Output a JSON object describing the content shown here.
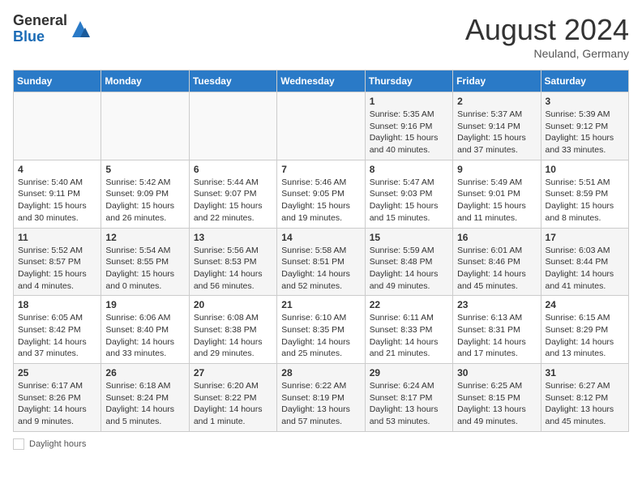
{
  "header": {
    "logo_general": "General",
    "logo_blue": "Blue",
    "month_year": "August 2024",
    "location": "Neuland, Germany"
  },
  "days_of_week": [
    "Sunday",
    "Monday",
    "Tuesday",
    "Wednesday",
    "Thursday",
    "Friday",
    "Saturday"
  ],
  "weeks": [
    [
      {
        "day": "",
        "info": ""
      },
      {
        "day": "",
        "info": ""
      },
      {
        "day": "",
        "info": ""
      },
      {
        "day": "",
        "info": ""
      },
      {
        "day": "1",
        "info": "Sunrise: 5:35 AM\nSunset: 9:16 PM\nDaylight: 15 hours and 40 minutes."
      },
      {
        "day": "2",
        "info": "Sunrise: 5:37 AM\nSunset: 9:14 PM\nDaylight: 15 hours and 37 minutes."
      },
      {
        "day": "3",
        "info": "Sunrise: 5:39 AM\nSunset: 9:12 PM\nDaylight: 15 hours and 33 minutes."
      }
    ],
    [
      {
        "day": "4",
        "info": "Sunrise: 5:40 AM\nSunset: 9:11 PM\nDaylight: 15 hours and 30 minutes."
      },
      {
        "day": "5",
        "info": "Sunrise: 5:42 AM\nSunset: 9:09 PM\nDaylight: 15 hours and 26 minutes."
      },
      {
        "day": "6",
        "info": "Sunrise: 5:44 AM\nSunset: 9:07 PM\nDaylight: 15 hours and 22 minutes."
      },
      {
        "day": "7",
        "info": "Sunrise: 5:46 AM\nSunset: 9:05 PM\nDaylight: 15 hours and 19 minutes."
      },
      {
        "day": "8",
        "info": "Sunrise: 5:47 AM\nSunset: 9:03 PM\nDaylight: 15 hours and 15 minutes."
      },
      {
        "day": "9",
        "info": "Sunrise: 5:49 AM\nSunset: 9:01 PM\nDaylight: 15 hours and 11 minutes."
      },
      {
        "day": "10",
        "info": "Sunrise: 5:51 AM\nSunset: 8:59 PM\nDaylight: 15 hours and 8 minutes."
      }
    ],
    [
      {
        "day": "11",
        "info": "Sunrise: 5:52 AM\nSunset: 8:57 PM\nDaylight: 15 hours and 4 minutes."
      },
      {
        "day": "12",
        "info": "Sunrise: 5:54 AM\nSunset: 8:55 PM\nDaylight: 15 hours and 0 minutes."
      },
      {
        "day": "13",
        "info": "Sunrise: 5:56 AM\nSunset: 8:53 PM\nDaylight: 14 hours and 56 minutes."
      },
      {
        "day": "14",
        "info": "Sunrise: 5:58 AM\nSunset: 8:51 PM\nDaylight: 14 hours and 52 minutes."
      },
      {
        "day": "15",
        "info": "Sunrise: 5:59 AM\nSunset: 8:48 PM\nDaylight: 14 hours and 49 minutes."
      },
      {
        "day": "16",
        "info": "Sunrise: 6:01 AM\nSunset: 8:46 PM\nDaylight: 14 hours and 45 minutes."
      },
      {
        "day": "17",
        "info": "Sunrise: 6:03 AM\nSunset: 8:44 PM\nDaylight: 14 hours and 41 minutes."
      }
    ],
    [
      {
        "day": "18",
        "info": "Sunrise: 6:05 AM\nSunset: 8:42 PM\nDaylight: 14 hours and 37 minutes."
      },
      {
        "day": "19",
        "info": "Sunrise: 6:06 AM\nSunset: 8:40 PM\nDaylight: 14 hours and 33 minutes."
      },
      {
        "day": "20",
        "info": "Sunrise: 6:08 AM\nSunset: 8:38 PM\nDaylight: 14 hours and 29 minutes."
      },
      {
        "day": "21",
        "info": "Sunrise: 6:10 AM\nSunset: 8:35 PM\nDaylight: 14 hours and 25 minutes."
      },
      {
        "day": "22",
        "info": "Sunrise: 6:11 AM\nSunset: 8:33 PM\nDaylight: 14 hours and 21 minutes."
      },
      {
        "day": "23",
        "info": "Sunrise: 6:13 AM\nSunset: 8:31 PM\nDaylight: 14 hours and 17 minutes."
      },
      {
        "day": "24",
        "info": "Sunrise: 6:15 AM\nSunset: 8:29 PM\nDaylight: 14 hours and 13 minutes."
      }
    ],
    [
      {
        "day": "25",
        "info": "Sunrise: 6:17 AM\nSunset: 8:26 PM\nDaylight: 14 hours and 9 minutes."
      },
      {
        "day": "26",
        "info": "Sunrise: 6:18 AM\nSunset: 8:24 PM\nDaylight: 14 hours and 5 minutes."
      },
      {
        "day": "27",
        "info": "Sunrise: 6:20 AM\nSunset: 8:22 PM\nDaylight: 14 hours and 1 minute."
      },
      {
        "day": "28",
        "info": "Sunrise: 6:22 AM\nSunset: 8:19 PM\nDaylight: 13 hours and 57 minutes."
      },
      {
        "day": "29",
        "info": "Sunrise: 6:24 AM\nSunset: 8:17 PM\nDaylight: 13 hours and 53 minutes."
      },
      {
        "day": "30",
        "info": "Sunrise: 6:25 AM\nSunset: 8:15 PM\nDaylight: 13 hours and 49 minutes."
      },
      {
        "day": "31",
        "info": "Sunrise: 6:27 AM\nSunset: 8:12 PM\nDaylight: 13 hours and 45 minutes."
      }
    ]
  ],
  "footer": {
    "daylight_label": "Daylight hours"
  }
}
